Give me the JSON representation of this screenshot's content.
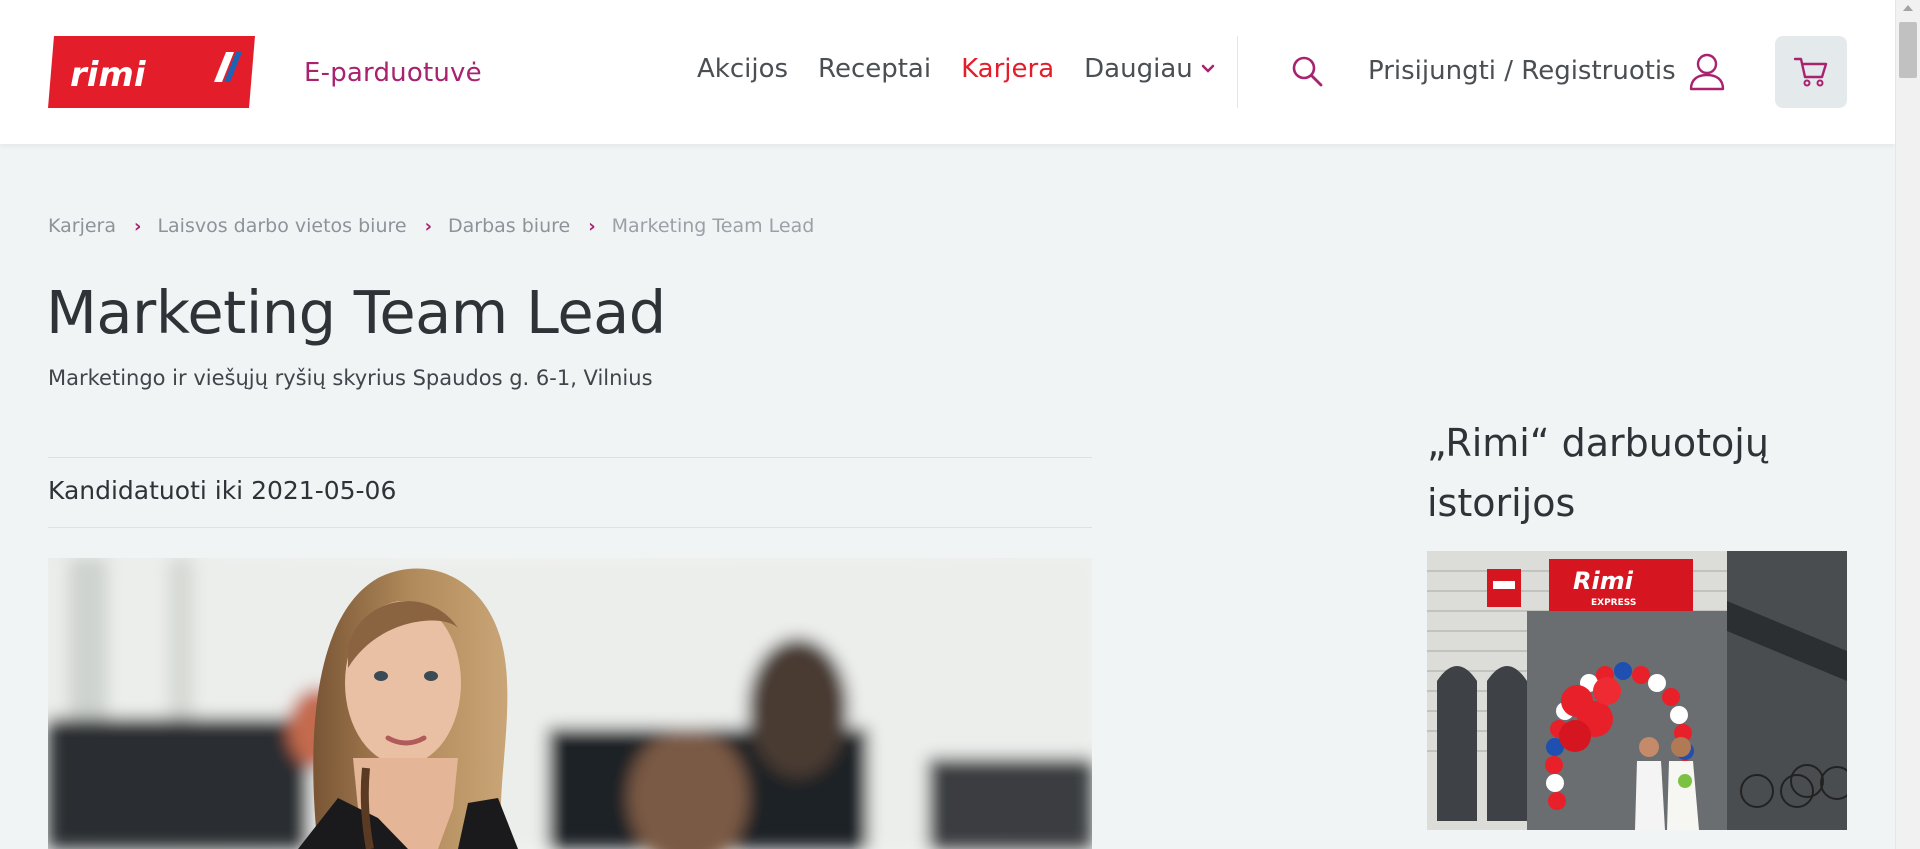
{
  "header": {
    "logo_text": "rimi",
    "eshop_label": "E-parduotuvė",
    "nav": [
      {
        "label": "Akcijos",
        "active": false
      },
      {
        "label": "Receptai",
        "active": false
      },
      {
        "label": "Karjera",
        "active": true
      }
    ],
    "more_label": "Daugiau",
    "login_label": "Prisijungti / Registruotis",
    "icons": [
      "search-icon",
      "user-icon",
      "cart-icon",
      "chevron-down-icon"
    ]
  },
  "breadcrumb": {
    "items": [
      "Karjera",
      "Laisvos darbo vietos biure",
      "Darbas biure"
    ],
    "current": "Marketing Team Lead"
  },
  "job": {
    "title": "Marketing Team Lead",
    "subtitle": "Marketingo ir viešųjų ryšių skyrius Spaudos g. 6-1, Vilnius",
    "deadline": "Kandidatuoti iki 2021-05-06"
  },
  "sidebar": {
    "title": "„Rimi“ darbuotojų istorijos",
    "photo_sign": "Rimi",
    "photo_sign_sub": "EXPRESS"
  },
  "colors": {
    "brand_red": "#e31e2a",
    "accent_purple": "#a8226e",
    "page_bg": "#f1f4f5",
    "text_dark": "#2e3338"
  }
}
